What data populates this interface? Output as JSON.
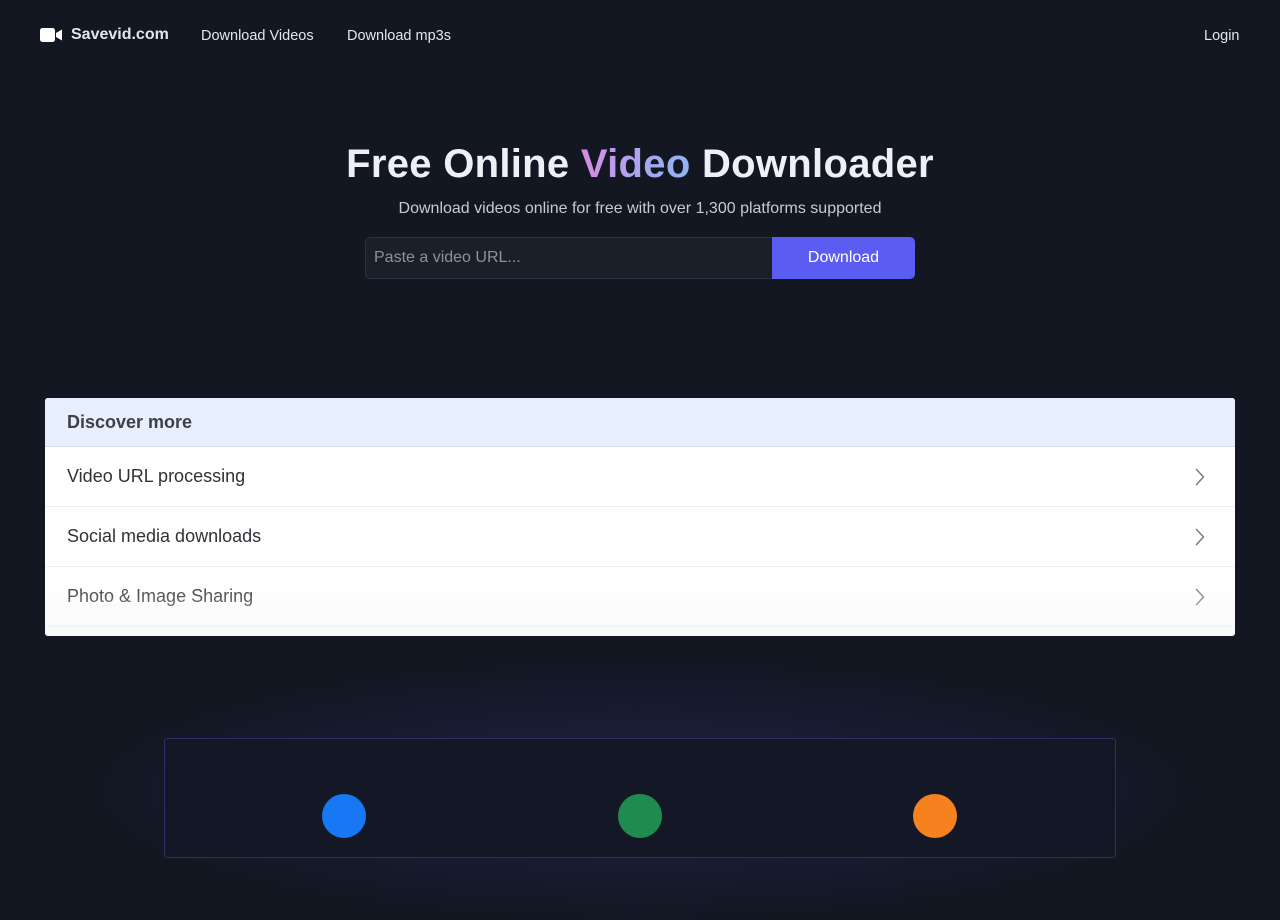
{
  "nav": {
    "logo_text": "Savevid.com",
    "logo_icon": "video-camera-icon",
    "links": [
      "Download Videos",
      "Download mp3s"
    ],
    "login_label": "Login"
  },
  "hero": {
    "title_before": "Free Online ",
    "title_highlight": "Video",
    "title_after": " Downloader",
    "subtitle": "Download videos online for free with over 1,300 platforms supported",
    "gradient_colors": [
      "#d68ce0",
      "#a9a6f0",
      "#8fb4f2"
    ]
  },
  "search": {
    "placeholder": "Paste a video URL...",
    "value": "",
    "button_label": "Download"
  },
  "discover": {
    "heading": "Discover more",
    "items": [
      {
        "label": "Video URL processing",
        "icon": "chevron-right-icon"
      },
      {
        "label": "Social media downloads",
        "icon": "chevron-right-icon"
      },
      {
        "label": "Photo & Image Sharing",
        "icon": "chevron-right-icon"
      }
    ]
  },
  "colors": {
    "background": "#131722",
    "accent": "#5b5cf1",
    "discover_header": "#e8effc",
    "feature_dots": [
      "#1877f2",
      "#1f8b4c",
      "#f6821f"
    ]
  }
}
